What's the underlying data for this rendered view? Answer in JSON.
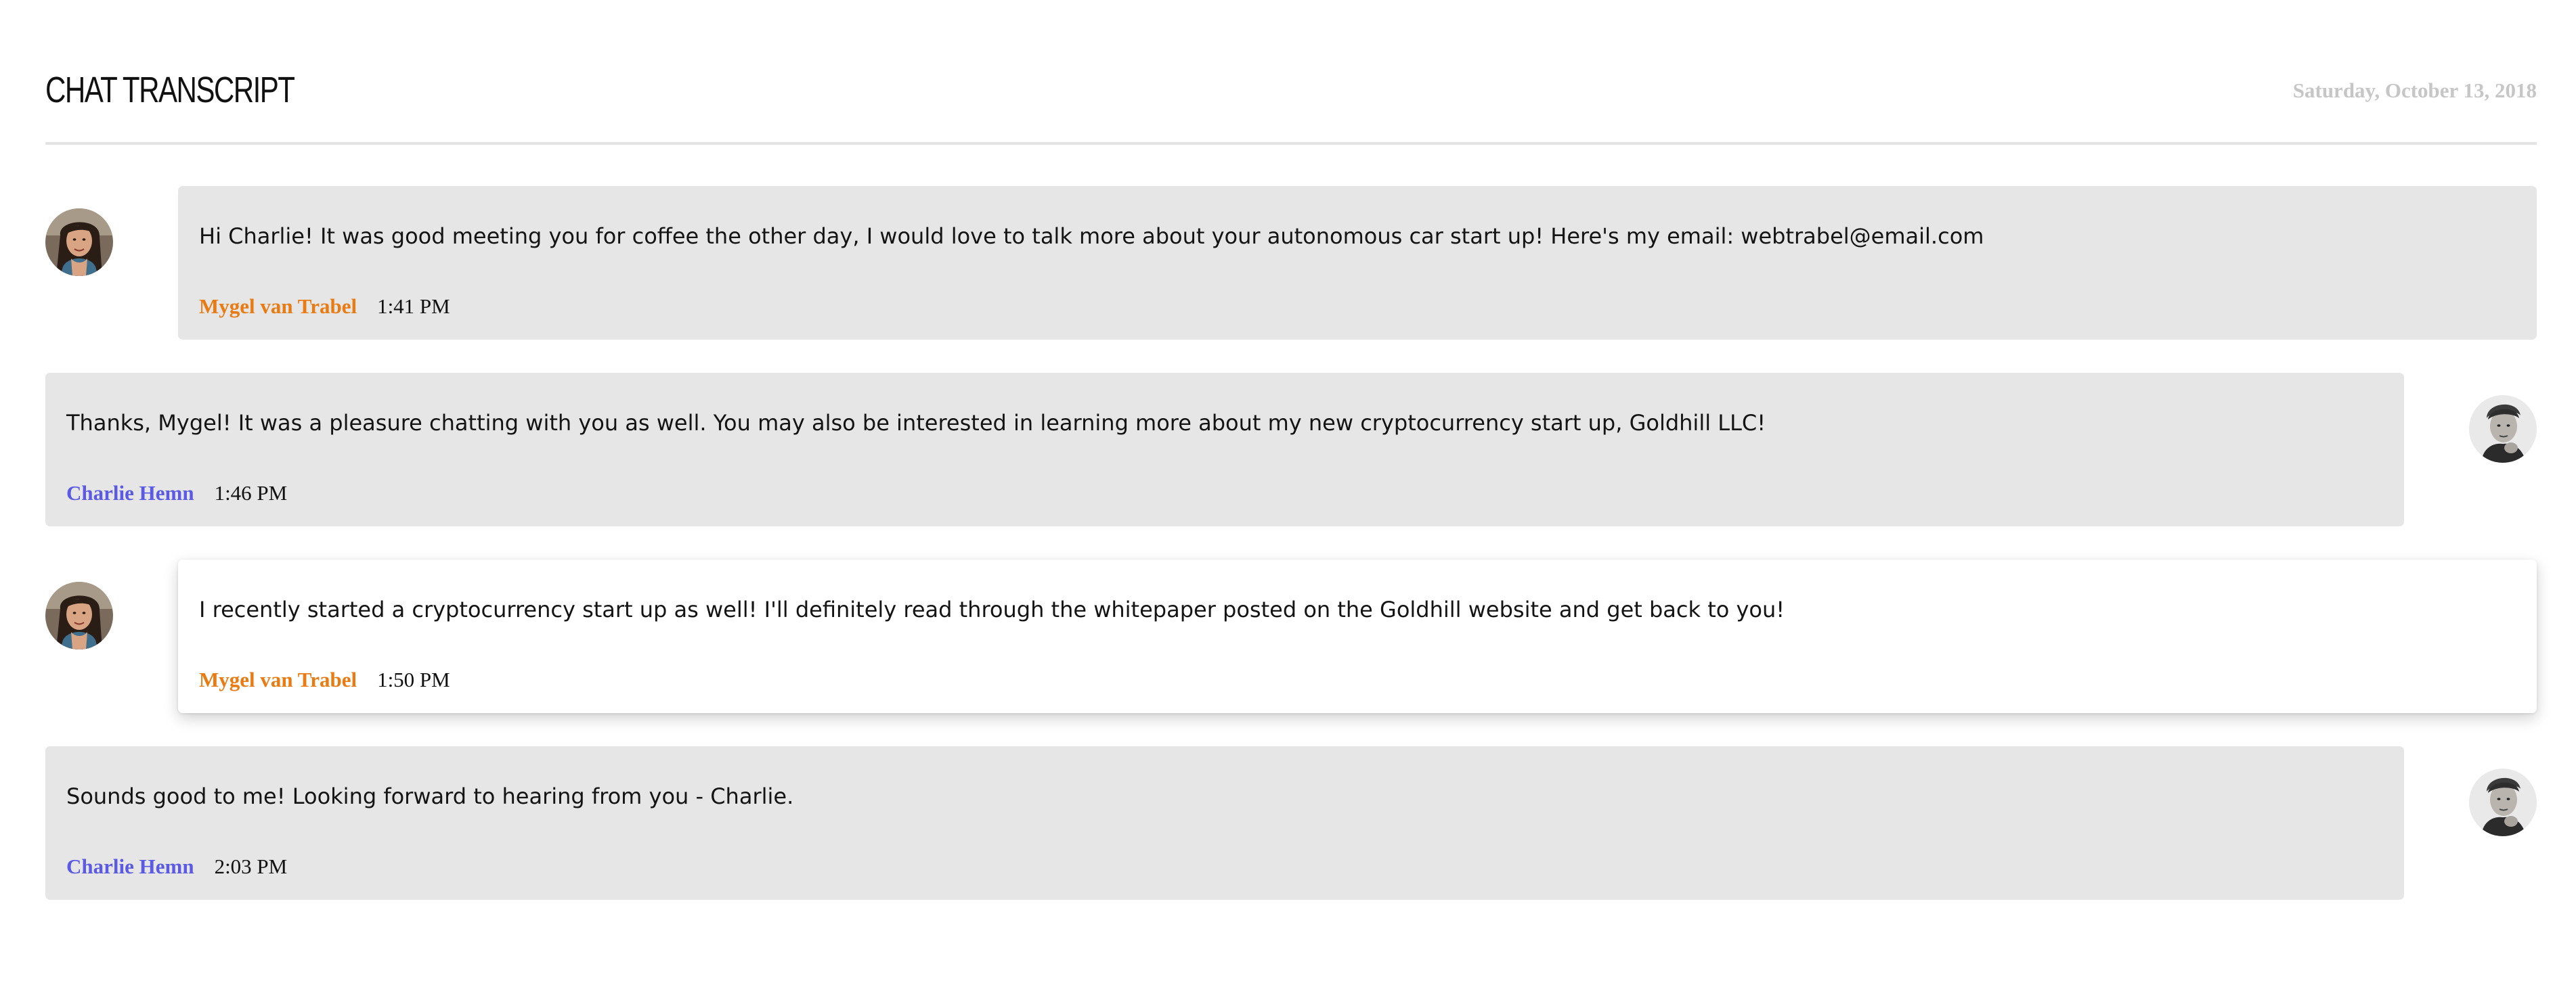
{
  "header": {
    "title": "CHAT TRANSCRIPT",
    "date": "Saturday, October 13, 2018"
  },
  "messages": [
    {
      "text": "Hi Charlie! It was good meeting you for coffee the other day, I would love to talk more about your autonomous car start up! Here's my email: webtrabel@email.com",
      "sender": "Mygel van Trabel",
      "time": "1:41 PM"
    },
    {
      "text": "Thanks, Mygel! It was a pleasure chatting with you as well. You may also be interested in learning more about my new cryptocurrency start up, Goldhill LLC!",
      "sender": "Charlie Hemn",
      "time": "1:46 PM"
    },
    {
      "text": "I recently started a cryptocurrency start up as well! I'll definitely read through the whitepaper posted on the Goldhill website and get back to you!",
      "sender": "Mygel van Trabel",
      "time": "1:50 PM"
    },
    {
      "text": "Sounds good to me! Looking forward to hearing from you - Charlie.",
      "sender": "Charlie Hemn",
      "time": "2:03 PM"
    }
  ],
  "colors": {
    "mygel_name": "#ea7a12",
    "charlie_name": "#5a5ae6",
    "bubble_bg": "#e6e6e6",
    "highlight_bg": "#ffffff",
    "date_text": "#c6c6c6"
  },
  "icons": {
    "mygel_avatar": "woman-portrait-avatar",
    "charlie_avatar": "man-portrait-avatar"
  }
}
